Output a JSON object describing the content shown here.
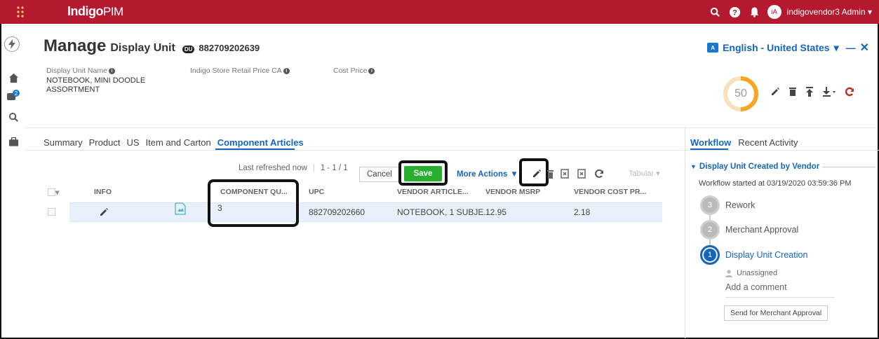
{
  "app": {
    "brand": "Indigo",
    "brand_suffix": "PIM",
    "user": "indigovendor3 Admin",
    "user_initials": "iA",
    "notifications_badge": "2"
  },
  "page": {
    "title_bold": "Manage",
    "title_rest": "Display Unit",
    "badge": "DU",
    "code": "882709202639"
  },
  "language": {
    "label": "English - United States"
  },
  "fields": [
    {
      "label": "Display Unit Name",
      "value": "NOTEBOOK, MINI DOODLE ASSORTMENT"
    },
    {
      "label": "Indigo Store Retail Price CA",
      "value": ""
    },
    {
      "label": "Cost Price",
      "value": ""
    }
  ],
  "score": {
    "value": "50",
    "fraction": 0.5
  },
  "tabs": [
    "Summary",
    "Product",
    "US",
    "Item and Carton",
    "Component Articles"
  ],
  "active_tab": "Component Articles",
  "toolbar": {
    "refreshed": "Last refreshed now",
    "range": "1 - 1 / 1",
    "cancel": "Cancel",
    "save": "Save",
    "more_actions": "More Actions",
    "view": "Tabular"
  },
  "table": {
    "columns": [
      "INFO",
      "COMPONENT QU...",
      "UPC",
      "VENDOR ARTICLE...",
      "VENDOR MSRP",
      "VENDOR COST PR..."
    ],
    "rows": [
      {
        "component_qty": "3",
        "upc": "882709202660",
        "vendor_article": "NOTEBOOK, 1 SUBJE...",
        "vendor_msrp": "12.95",
        "vendor_cost": "2.18"
      }
    ]
  },
  "right_panel": {
    "tabs": [
      "Workflow",
      "Recent Activity"
    ],
    "workflow_title": "Display Unit Created by Vendor",
    "started": "Workflow started at 03/19/2020 03:59:36 PM",
    "steps": [
      {
        "num": "3",
        "label": "Rework"
      },
      {
        "num": "2",
        "label": "Merchant Approval"
      },
      {
        "num": "1",
        "label": "Display Unit Creation"
      }
    ],
    "assignee": "Unassigned",
    "comment_placeholder": "Add a comment",
    "send_button": "Send for Merchant Approval"
  }
}
